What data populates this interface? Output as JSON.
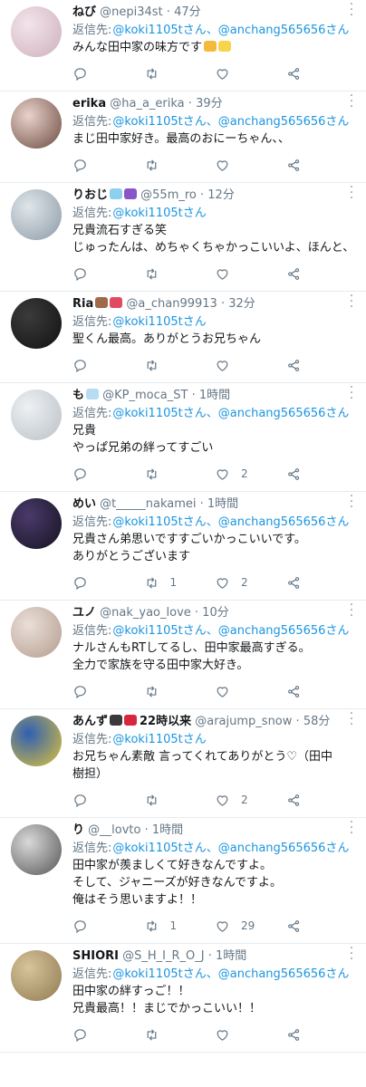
{
  "reply_prefix": "返信先:",
  "tweets": [
    {
      "name": "ねび",
      "handle": "@nepi34st",
      "time": "47分",
      "reply_to": [
        "@koki1105tさん、",
        "@anchang565656さん"
      ],
      "lines": [
        "みんな田中家の味方です"
      ],
      "emoji": [
        "#f5b93b",
        "#f7d54a"
      ],
      "avatar": [
        "#f3e4ea",
        "#cdb0bd"
      ],
      "counts": {
        "reply": "",
        "retweet": "",
        "like": ""
      }
    },
    {
      "name": "erika",
      "handle": "@ha_a_erika",
      "time": "39分",
      "reply_to": [
        "@koki1105tさん、",
        "@anchang565656さん"
      ],
      "lines": [
        "まじ田中家好き。最高のおにーちゃん、、"
      ],
      "emoji": [],
      "avatar": [
        "#e9d3cc",
        "#6b4a3f"
      ],
      "counts": {
        "reply": "",
        "retweet": "",
        "like": ""
      }
    },
    {
      "name": "りおじ",
      "handle": "@55m_ro",
      "time": "12分",
      "reply_to": [
        "@koki1105tさん"
      ],
      "lines": [
        "兄貴流石すぎる笑",
        "じゅったんは、めちゃくちゃかっこいいよ、ほんと、"
      ],
      "emoji": [
        "#8fd0ef",
        "#8a56c7"
      ],
      "avatar": [
        "#dfe6ea",
        "#8d9aa6"
      ],
      "counts": {
        "reply": "",
        "retweet": "",
        "like": ""
      }
    },
    {
      "name": "Ria",
      "handle": "@a_chan99913",
      "time": "32分",
      "reply_to": [
        "@koki1105tさん"
      ],
      "lines": [
        "聖くん最高。ありがとうお兄ちゃん"
      ],
      "emoji": [
        "#a0694a",
        "#e04b62"
      ],
      "avatar": [
        "#3b3b3b",
        "#111111"
      ],
      "counts": {
        "reply": "",
        "retweet": "",
        "like": ""
      }
    },
    {
      "name": "も",
      "handle": "@KP_moca_ST",
      "time": "1時間",
      "reply_to": [
        "@koki1105tさん、",
        "@anchang565656さん"
      ],
      "lines": [
        "兄貴",
        "やっぱ兄弟の絆ってすごい"
      ],
      "emoji": [
        "#b7dcf3"
      ],
      "avatar": [
        "#eef1f3",
        "#b9c0c6"
      ],
      "counts": {
        "reply": "",
        "retweet": "",
        "like": "2"
      }
    },
    {
      "name": "めい",
      "handle": "@t_____nakamei",
      "time": "1時間",
      "reply_to": [
        "@koki1105tさん、",
        "@anchang565656さん"
      ],
      "lines": [
        "兄貴さん弟思いですすごいかっこいいです。",
        "ありがとうございます"
      ],
      "emoji": [],
      "avatar": [
        "#4a3a6b",
        "#151320"
      ],
      "counts": {
        "reply": "",
        "retweet": "1",
        "like": "2"
      }
    },
    {
      "name": "ユノ",
      "handle": "@nak_yao_love",
      "time": "10分",
      "reply_to": [
        "@koki1105tさん、",
        "@anchang565656さん"
      ],
      "lines": [
        "ナルさんもRTしてるし、田中家最高すぎる。",
        "全力で家族を守る田中家大好き。"
      ],
      "emoji": [],
      "avatar": [
        "#eadfd8",
        "#b49c8f"
      ],
      "counts": {
        "reply": "",
        "retweet": "",
        "like": ""
      }
    },
    {
      "name": "あんず",
      "handle": "@arajump_snow",
      "time": "58分",
      "reply_to": [
        "@koki1105tさん"
      ],
      "lines": [
        "お兄ちゃん素敵 言ってくれてありがとう♡（田中",
        "樹担）"
      ],
      "emoji": [
        "#3a3a3a",
        "#d7263d"
      ],
      "extra_label": "22時以来",
      "avatar": [
        "#2f5fb3",
        "#e0c33a"
      ],
      "counts": {
        "reply": "",
        "retweet": "",
        "like": "2"
      }
    },
    {
      "name": "り",
      "handle": "@__lovto",
      "time": "1時間",
      "reply_to": [
        "@koki1105tさん、",
        "@anchang565656さん"
      ],
      "lines": [
        "田中家が羨ましくて好きなんですよ。",
        "そして、ジャニーズが好きなんですよ。",
        "俺はそう思いますよ！！"
      ],
      "emoji": [],
      "avatar": [
        "#d9d9d9",
        "#555555"
      ],
      "counts": {
        "reply": "",
        "retweet": "1",
        "like": "29"
      }
    },
    {
      "name": "SHIORI",
      "handle": "@S_H_I_R_O_J",
      "time": "1時間",
      "reply_to": [
        "@koki1105tさん、",
        "@anchang565656さん"
      ],
      "lines": [
        "田中家の絆すっご！！",
        "兄貴最高！！まじでかっこいい！！"
      ],
      "emoji": [],
      "avatar": [
        "#d8c49a",
        "#8f7a52"
      ],
      "counts": {
        "reply": "",
        "retweet": "",
        "like": ""
      }
    }
  ]
}
